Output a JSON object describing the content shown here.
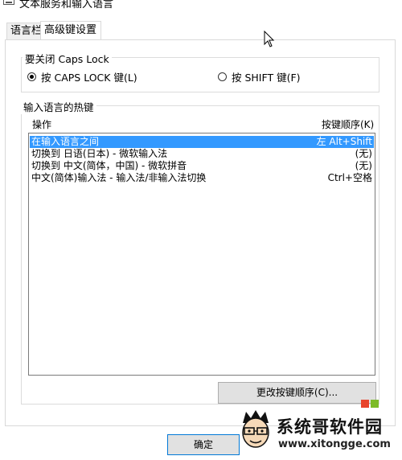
{
  "window": {
    "title": "文本服务和输入语言"
  },
  "tabs": [
    {
      "label": "语言栏"
    },
    {
      "label": "高级键设置"
    }
  ],
  "caps_lock": {
    "group_title": "要关闭 Caps Lock",
    "options": [
      {
        "label": "按 CAPS LOCK 键(L)",
        "selected": true
      },
      {
        "label": "按 SHIFT 键(F)",
        "selected": false
      }
    ]
  },
  "hotkeys": {
    "group_title": "输入语言的热键",
    "col_action": "操作",
    "col_keys": "按键顺序(K)",
    "rows": [
      {
        "action": "在输入语言之间",
        "keys": "左 Alt+Shift",
        "selected": true
      },
      {
        "action": "切换到 日语(日本) - 微软输入法",
        "keys": "(无)",
        "selected": false
      },
      {
        "action": "切换到 中文(简体，中国) - 微软拼音",
        "keys": "(无)",
        "selected": false
      },
      {
        "action": "中文(简体)输入法 - 输入法/非输入法切换",
        "keys": "Ctrl+空格",
        "selected": false
      }
    ],
    "change_button": "更改按键顺序(C)..."
  },
  "footer": {
    "ok_button": "确定"
  },
  "watermark": {
    "brand": "系统哥软件园",
    "url": "www.xitongge.com"
  },
  "icons": {
    "window": "keyboard-icon",
    "cursor": "mouse-pointer-icon",
    "mascot": "mascot-face-icon",
    "logo": "windows-logo-icon"
  },
  "colors": {
    "selection": "#3399ff",
    "button_face": "#e1e1e1",
    "focus_border": "#0078d7"
  }
}
